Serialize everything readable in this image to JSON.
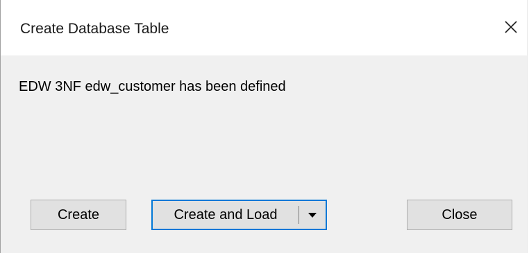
{
  "dialog": {
    "title": "Create Database Table",
    "message": "EDW 3NF edw_customer has been defined"
  },
  "buttons": {
    "create_label": "Create",
    "create_and_load_label": "Create and Load",
    "close_label": "Close"
  },
  "icons": {
    "window_close": "close-icon",
    "dropdown": "triangle-down-icon"
  },
  "colors": {
    "dialog_background": "#f0f0f0",
    "titlebar_background": "#ffffff",
    "focused_button_border": "#0078d7",
    "button_background": "#e1e1e1"
  }
}
